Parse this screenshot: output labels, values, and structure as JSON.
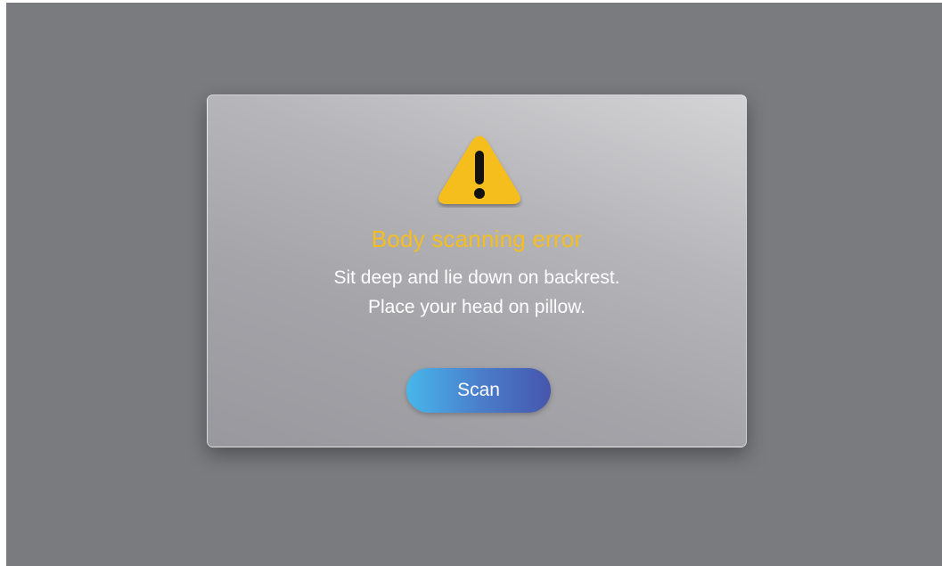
{
  "dialog": {
    "icon": "warning-icon",
    "title": "Body scanning error",
    "message_line1": "Sit deep and lie down on backrest.",
    "message_line2": "Place your head on pillow.",
    "scan_button_label": "Scan"
  },
  "colors": {
    "overlay": "#7a7b7f",
    "title": "#f5be1e",
    "warning_fill": "#f5be1e",
    "button_gradient_start": "#48b6ea",
    "button_gradient_end": "#4656ac"
  }
}
